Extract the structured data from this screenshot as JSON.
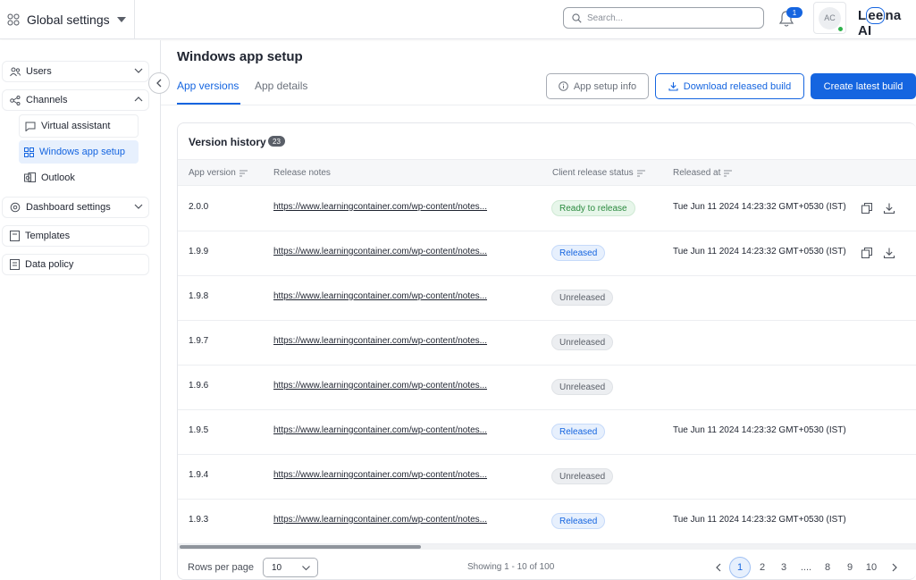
{
  "header": {
    "app_title": "Global settings",
    "search_placeholder": "Search...",
    "notification_count": "1",
    "avatar_initials": "AC",
    "logo_text": "Leena AI"
  },
  "sidebar": {
    "items": [
      {
        "label": "Users",
        "icon": "users-icon"
      },
      {
        "label": "Channels",
        "icon": "channels-icon"
      },
      {
        "label": "Virtual assistant",
        "icon": "chat-icon"
      },
      {
        "label": "Windows app setup",
        "icon": "windows-icon"
      },
      {
        "label": "Outlook",
        "icon": "outlook-icon"
      },
      {
        "label": "Dashboard settings",
        "icon": "gear-icon"
      },
      {
        "label": "Templates",
        "icon": "template-icon"
      },
      {
        "label": "Data policy",
        "icon": "policy-icon"
      }
    ]
  },
  "main": {
    "title": "Windows app setup",
    "tabs": [
      {
        "label": "App versions"
      },
      {
        "label": "App details"
      }
    ],
    "buttons": {
      "info": "App setup info",
      "download": "Download released build",
      "create": "Create latest build"
    }
  },
  "table": {
    "title": "Version history",
    "count": "23",
    "columns": [
      "App version",
      "Release notes",
      "Client release status",
      "Released at"
    ],
    "rows": [
      {
        "version": "2.0.0",
        "notes": "https://www.learningcontainer.com/wp-content/notes...",
        "status": "Ready to release",
        "status_kind": "ready",
        "released_at": "Tue Jun 11 2024 14:23:32 GMT+0530 (IST)",
        "actions": true
      },
      {
        "version": "1.9.9",
        "notes": "https://www.learningcontainer.com/wp-content/notes...",
        "status": "Released",
        "status_kind": "released",
        "released_at": "Tue Jun 11 2024 14:23:32 GMT+0530 (IST)",
        "actions": true
      },
      {
        "version": "1.9.8",
        "notes": "https://www.learningcontainer.com/wp-content/notes...",
        "status": "Unreleased",
        "status_kind": "unreleased",
        "released_at": "",
        "actions": false
      },
      {
        "version": "1.9.7",
        "notes": "https://www.learningcontainer.com/wp-content/notes...",
        "status": "Unreleased",
        "status_kind": "unreleased",
        "released_at": "",
        "actions": false
      },
      {
        "version": "1.9.6",
        "notes": "https://www.learningcontainer.com/wp-content/notes...",
        "status": "Unreleased",
        "status_kind": "unreleased",
        "released_at": "",
        "actions": false
      },
      {
        "version": "1.9.5",
        "notes": "https://www.learningcontainer.com/wp-content/notes...",
        "status": "Released",
        "status_kind": "released",
        "released_at": "Tue Jun 11 2024 14:23:32 GMT+0530 (IST)",
        "actions": false
      },
      {
        "version": "1.9.4",
        "notes": "https://www.learningcontainer.com/wp-content/notes...",
        "status": "Unreleased",
        "status_kind": "unreleased",
        "released_at": "",
        "actions": false
      },
      {
        "version": "1.9.3",
        "notes": "https://www.learningcontainer.com/wp-content/notes...",
        "status": "Released",
        "status_kind": "released",
        "released_at": "Tue Jun 11 2024 14:23:32 GMT+0530 (IST)",
        "actions": false
      }
    ]
  },
  "footer": {
    "rows_per_page_label": "Rows per page",
    "rows_per_page_value": "10",
    "showing": "Showing 1 - 10 of 100",
    "pages": [
      "1",
      "2",
      "3",
      "....",
      "8",
      "9",
      "10"
    ],
    "current_page": "1"
  },
  "colors": {
    "accent": "#1565e0",
    "released": "#1565e0",
    "ready": "#2a8a3e",
    "unreleased": "#5a5f68",
    "online": "#2fb24c"
  }
}
